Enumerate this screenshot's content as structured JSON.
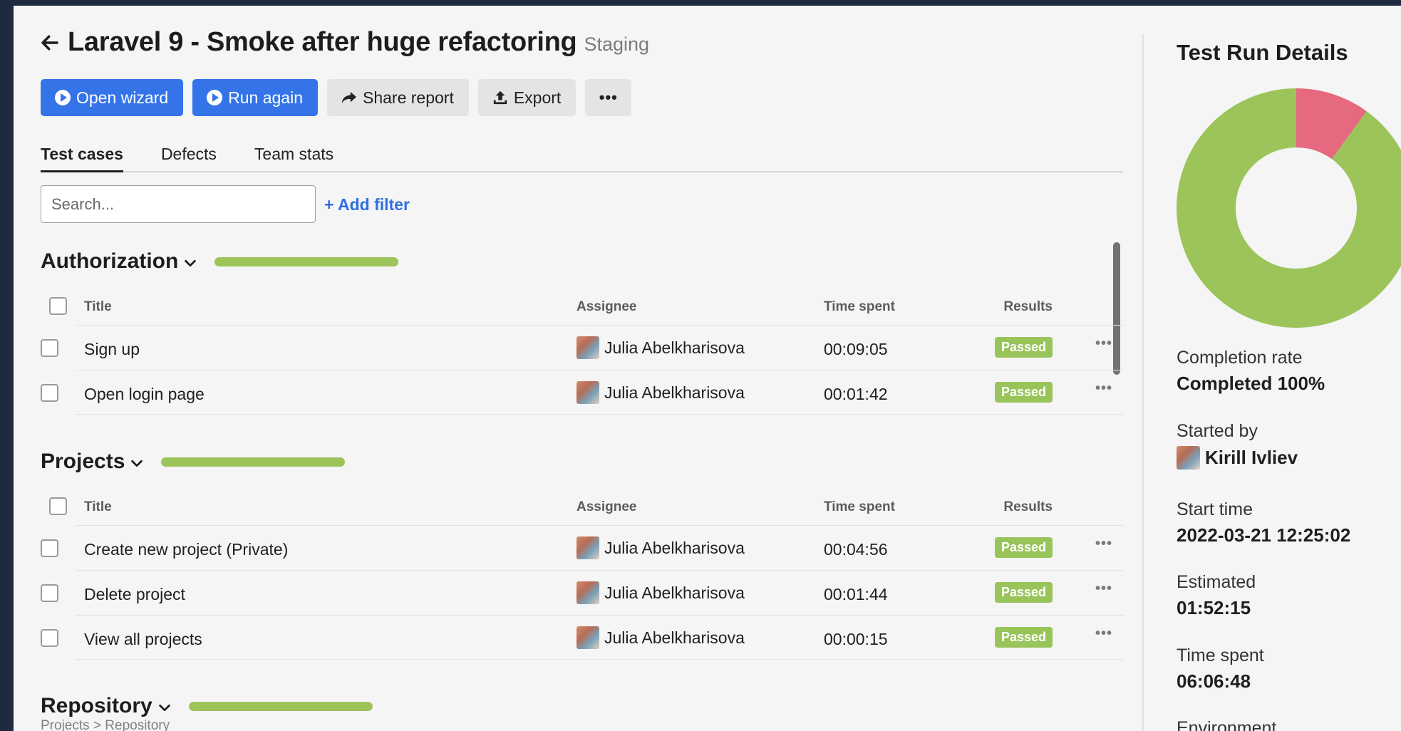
{
  "header": {
    "title": "Laravel 9 - Smoke after huge refactoring",
    "environment": "Staging"
  },
  "toolbar": {
    "open_wizard": "Open wizard",
    "run_again": "Run again",
    "share_report": "Share report",
    "export": "Export",
    "more": "•••"
  },
  "tabs": [
    "Test cases",
    "Defects",
    "Team stats"
  ],
  "search": {
    "placeholder": "Search...",
    "add_filter": "+ Add filter"
  },
  "columns": {
    "title": "Title",
    "assignee": "Assignee",
    "time_spent": "Time spent",
    "results": "Results"
  },
  "suites": [
    {
      "name": "Authorization",
      "progress": 1.0,
      "rows": [
        {
          "title": "Sign up",
          "assignee": "Julia Abelkharisova",
          "time": "00:09:05",
          "result": "Passed"
        },
        {
          "title": "Open login page",
          "assignee": "Julia Abelkharisova",
          "time": "00:01:42",
          "result": "Passed"
        }
      ]
    },
    {
      "name": "Projects",
      "progress": 1.0,
      "rows": [
        {
          "title": "Create new project (Private)",
          "assignee": "Julia Abelkharisova",
          "time": "00:04:56",
          "result": "Passed"
        },
        {
          "title": "Delete project",
          "assignee": "Julia Abelkharisova",
          "time": "00:01:44",
          "result": "Passed"
        },
        {
          "title": "View all projects",
          "assignee": "Julia Abelkharisova",
          "time": "00:00:15",
          "result": "Passed"
        }
      ]
    },
    {
      "name": "Repository",
      "progress": 1.0,
      "breadcrumb": "Projects > Repository"
    }
  ],
  "row_more": "•••",
  "details": {
    "title": "Test Run Details",
    "donut": {
      "passed_fraction": 0.9,
      "failed_fraction": 0.1
    },
    "completion_label": "Completion rate",
    "completion_value": "Completed 100%",
    "started_by_label": "Started by",
    "started_by_value": "Kirill Ivliev",
    "start_time_label": "Start time",
    "start_time_value": "2022-03-21 12:25:02",
    "estimated_label": "Estimated",
    "estimated_value": "01:52:15",
    "time_spent_label": "Time spent",
    "time_spent_value": "06:06:48",
    "environment_label": "Environment"
  },
  "colors": {
    "primary": "#3474e8",
    "passed": "#98c45a",
    "failed": "#e5697f",
    "donut_green": "#9dc45a"
  }
}
